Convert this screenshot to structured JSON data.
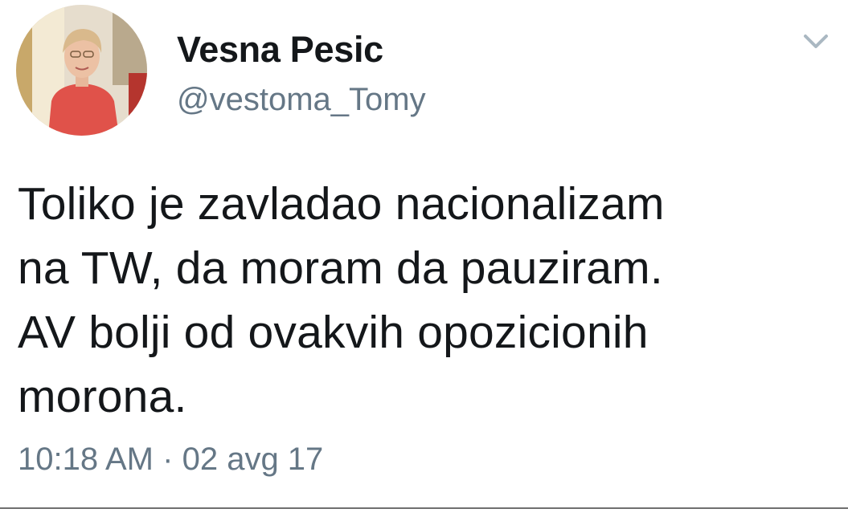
{
  "author": {
    "name": "Vesna Pesic",
    "handle": "@vestoma_Tomy"
  },
  "tweet": {
    "lines": [
      "Toliko je zavladao nacionalizam",
      "na TW, da moram da pauziram.",
      "AV bolji od ovakvih opozicionih",
      "morona."
    ],
    "time": "10:18 AM",
    "separator": "·",
    "date": "02 avg 17"
  },
  "icons": {
    "menu": "chevron-down-icon",
    "avatar": "profile-photo"
  },
  "colors": {
    "text": "#14171a",
    "secondary": "#657786",
    "chevron": "#aab8c2"
  }
}
